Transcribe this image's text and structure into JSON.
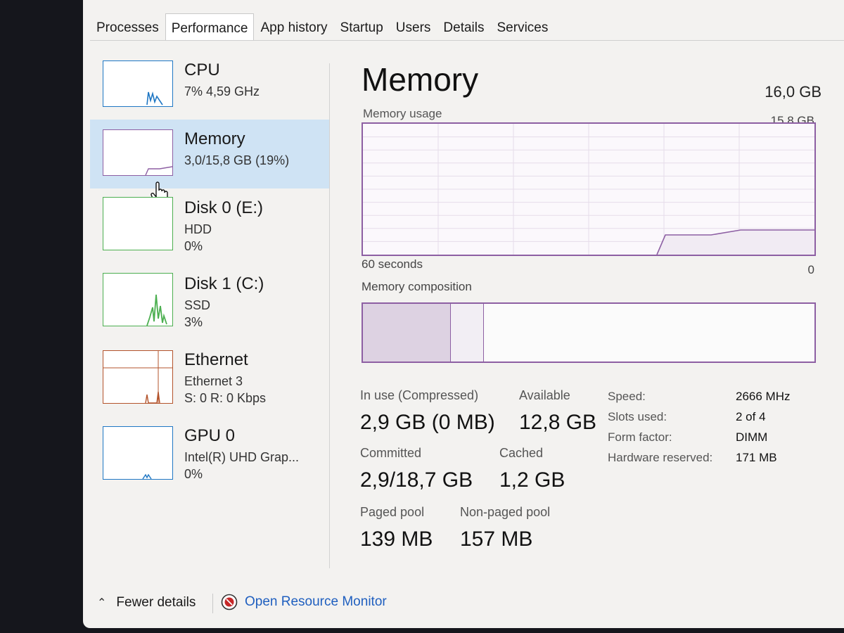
{
  "tabs": [
    "Processes",
    "Performance",
    "App history",
    "Startup",
    "Users",
    "Details",
    "Services"
  ],
  "active_tab": "Performance",
  "sidebar": {
    "items": [
      {
        "name": "CPU",
        "sub1": "7% 4,59 GHz",
        "sub2": ""
      },
      {
        "name": "Memory",
        "sub1": "3,0/15,8 GB (19%)",
        "sub2": ""
      },
      {
        "name": "Disk 0 (E:)",
        "sub1": "HDD",
        "sub2": "0%"
      },
      {
        "name": "Disk 1 (C:)",
        "sub1": "SSD",
        "sub2": "3%"
      },
      {
        "name": "Ethernet",
        "sub1": "Ethernet 3",
        "sub2": "S: 0 R: 0 Kbps"
      },
      {
        "name": "GPU 0",
        "sub1": "Intel(R) UHD Grap...",
        "sub2": "0%"
      }
    ],
    "selected": "Memory"
  },
  "main": {
    "title": "Memory",
    "total": "16,0 GB",
    "usage_label": "Memory usage",
    "usage_max": "15,8 GB",
    "time_label": "60 seconds",
    "time_end": "0",
    "composition_label": "Memory composition",
    "stats": {
      "in_use_label": "In use (Compressed)",
      "in_use_value": "2,9 GB (0 MB)",
      "available_label": "Available",
      "available_value": "12,8 GB",
      "committed_label": "Committed",
      "committed_value": "2,9/18,7 GB",
      "cached_label": "Cached",
      "cached_value": "1,2 GB",
      "paged_label": "Paged pool",
      "paged_value": "139 MB",
      "nonpaged_label": "Non-paged pool",
      "nonpaged_value": "157 MB"
    },
    "details": [
      {
        "label": "Speed:",
        "value": "2666 MHz"
      },
      {
        "label": "Slots used:",
        "value": "2 of 4"
      },
      {
        "label": "Form factor:",
        "value": "DIMM"
      },
      {
        "label": "Hardware reserved:",
        "value": "171 MB"
      }
    ]
  },
  "footer": {
    "fewer_details": "Fewer details",
    "open_monitor": "Open Resource Monitor"
  },
  "colors": {
    "memory": "#8d5fa3",
    "cpu": "#1f77c4",
    "disk": "#4caf50",
    "ethernet": "#b3532b",
    "gpu": "#1f77c4",
    "selected_bg": "#cfe3f4",
    "link": "#1f5fbf"
  },
  "icons": [
    "chevron-up-icon",
    "resource-monitor-icon",
    "hand-cursor-icon"
  ]
}
